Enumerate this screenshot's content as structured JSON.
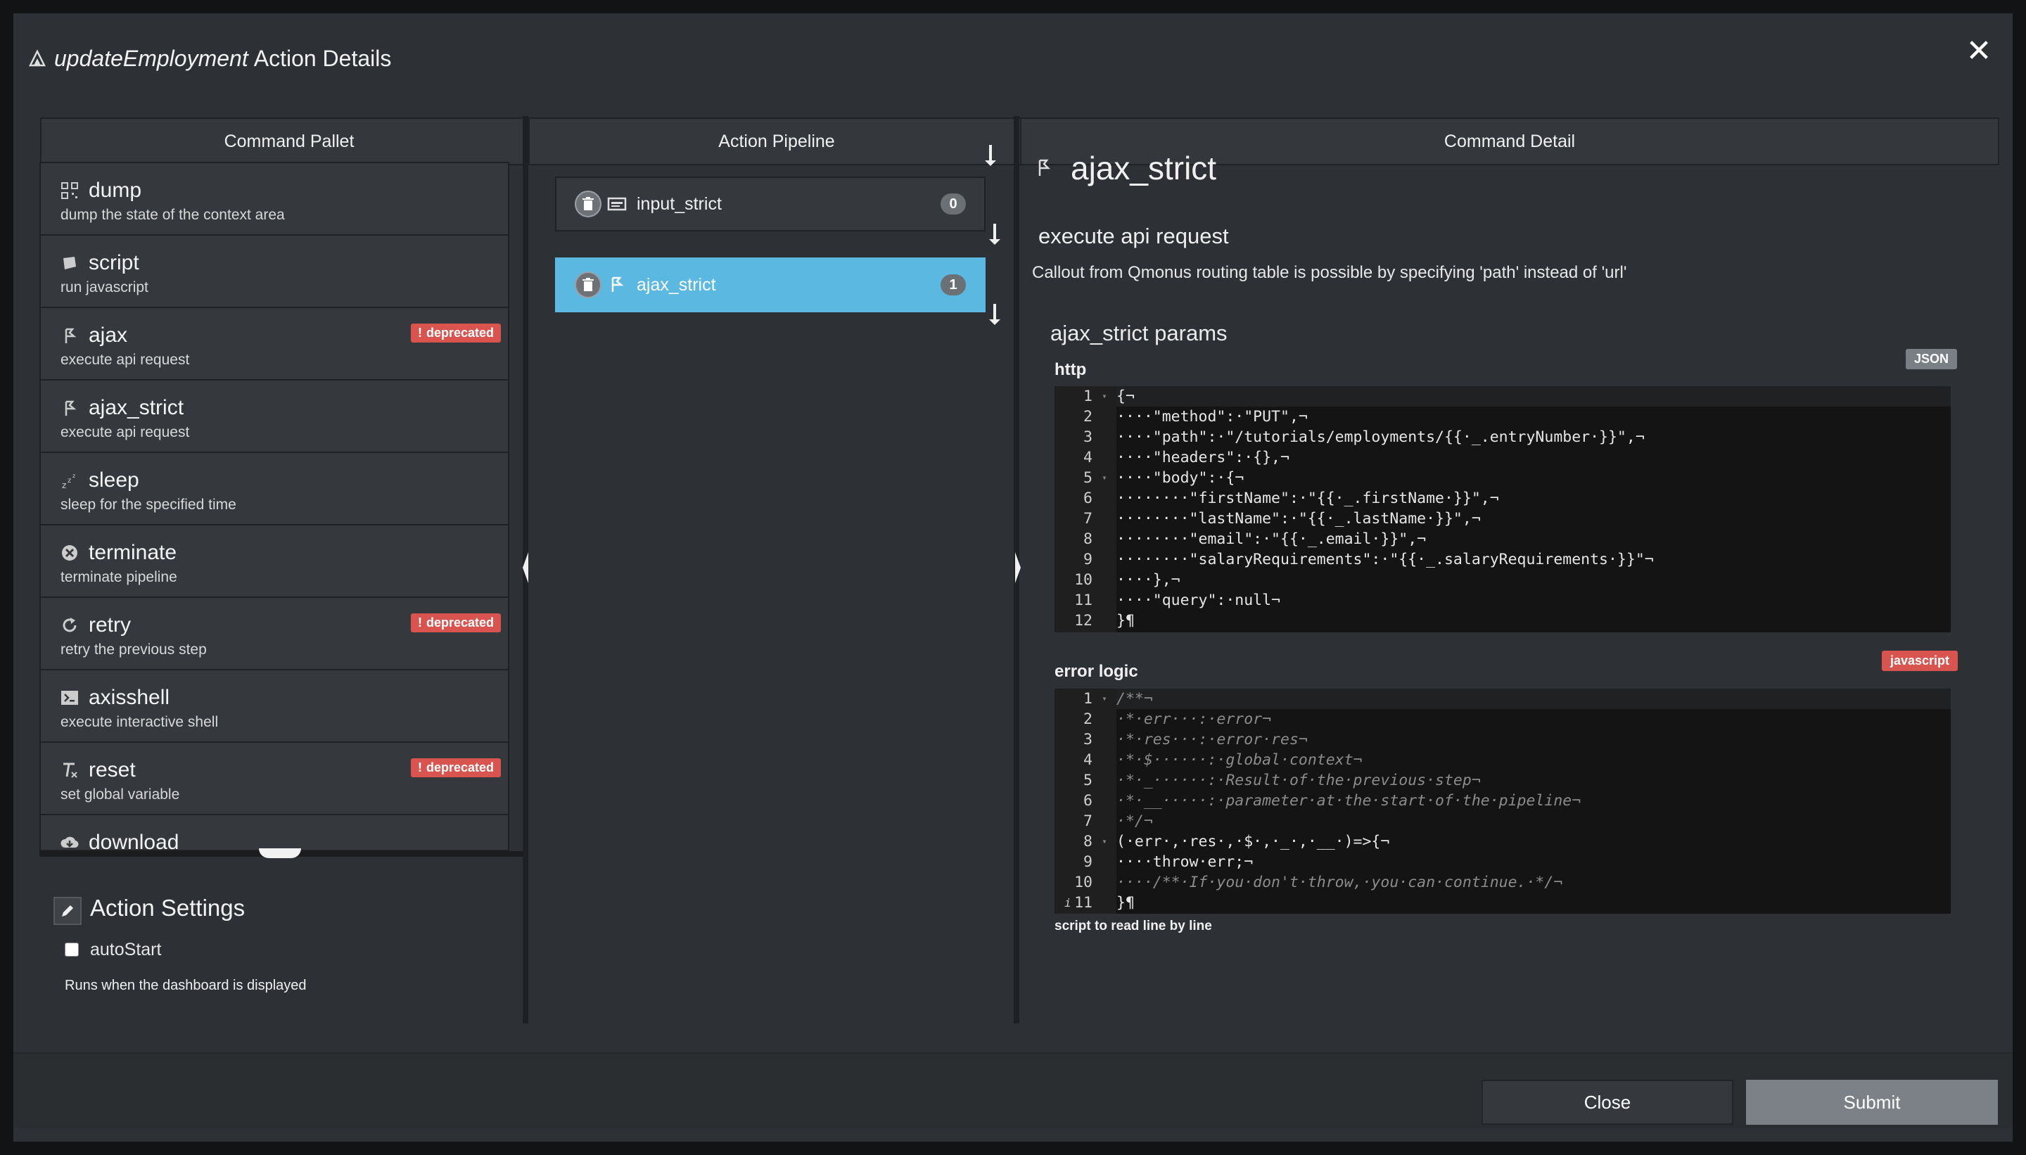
{
  "modal": {
    "title_italic": "updateEmployment",
    "title_rest": "Action Details",
    "close_glyph": "✕"
  },
  "columns": {
    "palette": "Command Pallet",
    "pipeline": "Action Pipeline",
    "detail": "Command Detail"
  },
  "palette": {
    "items": [
      {
        "name": "dump",
        "desc": "dump the state of the context area",
        "icon": "qr-icon",
        "deprecated": false
      },
      {
        "name": "script",
        "desc": "run javascript",
        "icon": "script-icon",
        "deprecated": false
      },
      {
        "name": "ajax",
        "desc": "execute api request",
        "icon": "ajax-icon",
        "deprecated": true
      },
      {
        "name": "ajax_strict",
        "desc": "execute api request",
        "icon": "ajax-icon",
        "deprecated": false
      },
      {
        "name": "sleep",
        "desc": "sleep for the specified time",
        "icon": "sleep-icon",
        "deprecated": false
      },
      {
        "name": "terminate",
        "desc": "terminate pipeline",
        "icon": "terminate-icon",
        "deprecated": false
      },
      {
        "name": "retry",
        "desc": "retry the previous step",
        "icon": "retry-icon",
        "deprecated": true
      },
      {
        "name": "axisshell",
        "desc": "execute interactive shell",
        "icon": "terminal-icon",
        "deprecated": false
      },
      {
        "name": "reset",
        "desc": "set global variable",
        "icon": "clear-format-icon",
        "deprecated": true
      },
      {
        "name": "download",
        "desc": "",
        "icon": "download-icon",
        "deprecated": false
      }
    ],
    "deprecated_label": "deprecated",
    "deprecated_mark": "!"
  },
  "settings": {
    "title": "Action Settings",
    "autostart_label": "autoStart",
    "autostart_checked": false,
    "autostart_help": "Runs when the dashboard is displayed"
  },
  "pipeline": {
    "items": [
      {
        "name": "input_strict",
        "index": "0",
        "active": false
      },
      {
        "name": "ajax_strict",
        "index": "1",
        "active": true
      }
    ]
  },
  "detail": {
    "name": "ajax_strict",
    "subtitle": "execute api request",
    "description": "Callout from Qmonus routing table is possible by specifying 'path' instead of 'url'",
    "params_title": "ajax_strict params",
    "http_label": "http",
    "http_tag": "JSON",
    "http_code": [
      "{¬",
      "····\"method\":·\"PUT\",¬",
      "····\"path\":·\"/tutorials/employments/{{·_.entryNumber·}}\",¬",
      "····\"headers\":·{},¬",
      "····\"body\":·{¬",
      "········\"firstName\":·\"{{·_.firstName·}}\",¬",
      "········\"lastName\":·\"{{·_.lastName·}}\",¬",
      "········\"email\":·\"{{·_.email·}}\",¬",
      "········\"salaryRequirements\":·\"{{·_.salaryRequirements·}}\"¬",
      "····},¬",
      "····\"query\":·null¬",
      "}¶"
    ],
    "error_label": "error logic",
    "error_tag": "javascript",
    "error_code": [
      "/**¬",
      "·*·err···:·error¬",
      "·*·res···:·error·res¬",
      "·*·$······:·global·context¬",
      "·*·_······:·Result·of·the·previous·step¬",
      "·*·__·····:·parameter·at·the·start·of·the·pipeline¬",
      "·*/¬",
      "(·err·,·res·,·$·,·_·,·__·)=>{¬",
      "····throw·err;¬",
      "····/**·If·you·don't·throw,·you·can·continue.·*/¬",
      "}¶"
    ],
    "error_info_mark": "i",
    "helptext": "script to read line by line"
  },
  "footer": {
    "close_label": "Close",
    "submit_label": "Submit"
  },
  "colors": {
    "accent_active": "#5bb8e0",
    "deprecated": "#d9534f",
    "submit": "#7c8188"
  }
}
